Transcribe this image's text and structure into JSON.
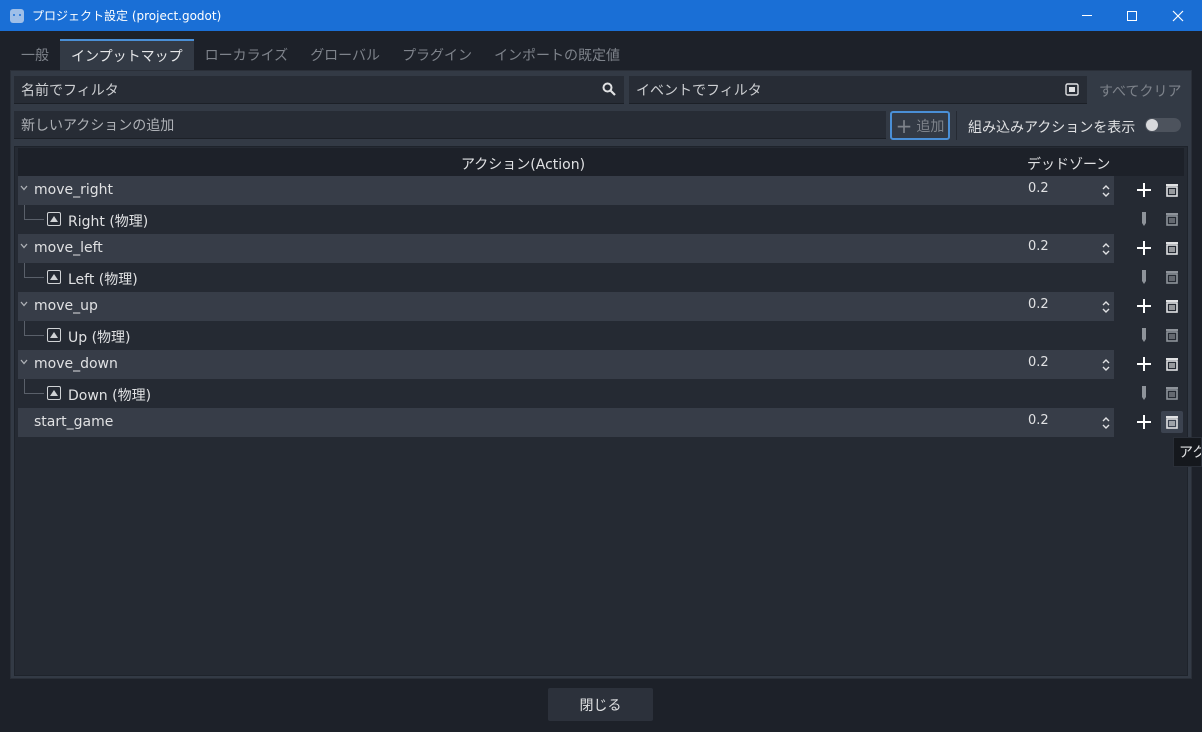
{
  "window": {
    "title": "プロジェクト設定 (project.godot)"
  },
  "tabs": [
    {
      "label": "一般"
    },
    {
      "label": "インプットマップ"
    },
    {
      "label": "ローカライズ"
    },
    {
      "label": "グローバル"
    },
    {
      "label": "プラグイン"
    },
    {
      "label": "インポートの既定値"
    }
  ],
  "filters": {
    "name_placeholder": "名前でフィルタ",
    "event_placeholder": "イベントでフィルタ",
    "clear_all": "すべてクリア"
  },
  "add_action": {
    "placeholder": "新しいアクションの追加",
    "add_label": "追加",
    "builtin_label": "組み込みアクションを表示",
    "builtin_on": false
  },
  "tree": {
    "header_action": "アクション(Action)",
    "header_deadzone": "デッドゾーン",
    "actions": [
      {
        "name": "move_right",
        "deadzone": "0.2",
        "event": "Right (物理)"
      },
      {
        "name": "move_left",
        "deadzone": "0.2",
        "event": "Left (物理)"
      },
      {
        "name": "move_up",
        "deadzone": "0.2",
        "event": "Up (物理)"
      },
      {
        "name": "move_down",
        "deadzone": "0.2",
        "event": "Down (物理)"
      },
      {
        "name": "start_game",
        "deadzone": "0.2",
        "event": null
      }
    ]
  },
  "tooltip": "アク",
  "footer": {
    "close_label": "閉じる"
  },
  "colors": {
    "titlebar": "#1a6fd6",
    "accent": "#4a8fd6",
    "background": "#1d2129"
  }
}
